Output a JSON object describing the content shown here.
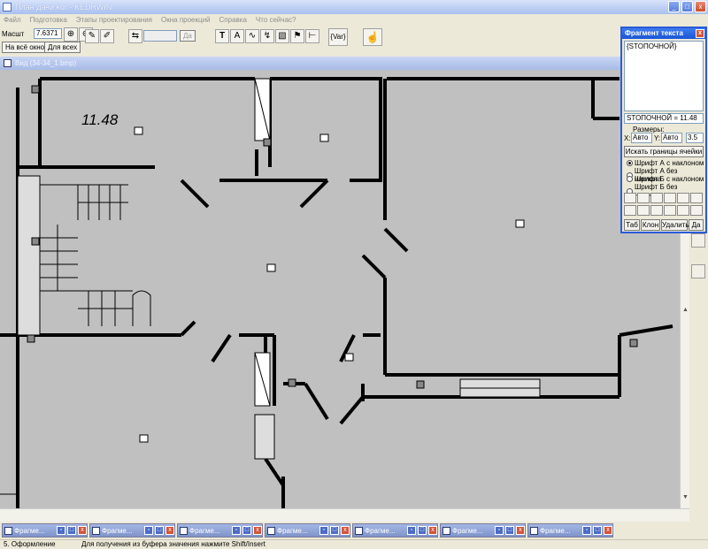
{
  "window": {
    "title": "План дачи.kdr - KEDRWIN",
    "min": "_",
    "max": "□",
    "close": "x"
  },
  "menu": [
    "Файл",
    "Подготовка",
    "Этапы проектирования",
    "Окна проекций",
    "Справка",
    "Что сейчас?"
  ],
  "toolbar": {
    "scale_label": "Масшт",
    "scale_value": "7.6371",
    "fit_all": "На всё окно",
    "for_all": "Для всех",
    "yes": "Да",
    "text_tool": "T",
    "var_tool": "{Var}"
  },
  "document": {
    "title": "Вид (34-34_1.bmp)"
  },
  "plan": {
    "room_label": "11.48"
  },
  "panel": {
    "title": "Фрагмент текста",
    "close": "x",
    "text_content": "{STOПОЧНОЙ}",
    "assignment": "STOПОЧНОЙ = 11.48",
    "sizes_label": "Размеры:",
    "x_label": "X:",
    "x_value": "Авто",
    "y_label": "Y:",
    "y_value": "Авто",
    "size_value": "3.5",
    "find_borders": "Искать границы ячейки",
    "font_options": [
      "Шрифт А с наклоном",
      "Шрифт А без наклона",
      "Шрифт Б с наклоном",
      "Шрифт Б без наклона"
    ],
    "buttons": {
      "tab": "Таб",
      "clone": "Клон",
      "delete": "Удалить",
      "yes": "Да"
    }
  },
  "taskbar": {
    "items": [
      "Фрагме...",
      "Фрагме...",
      "Фрагме...",
      "Фрагме...",
      "Фрагме...",
      "Фрагме...",
      "Фрагме..."
    ]
  },
  "status": {
    "mode": "5. Оформление",
    "hint": "Для получения из буфера значения нажмите Shift/Insert"
  }
}
